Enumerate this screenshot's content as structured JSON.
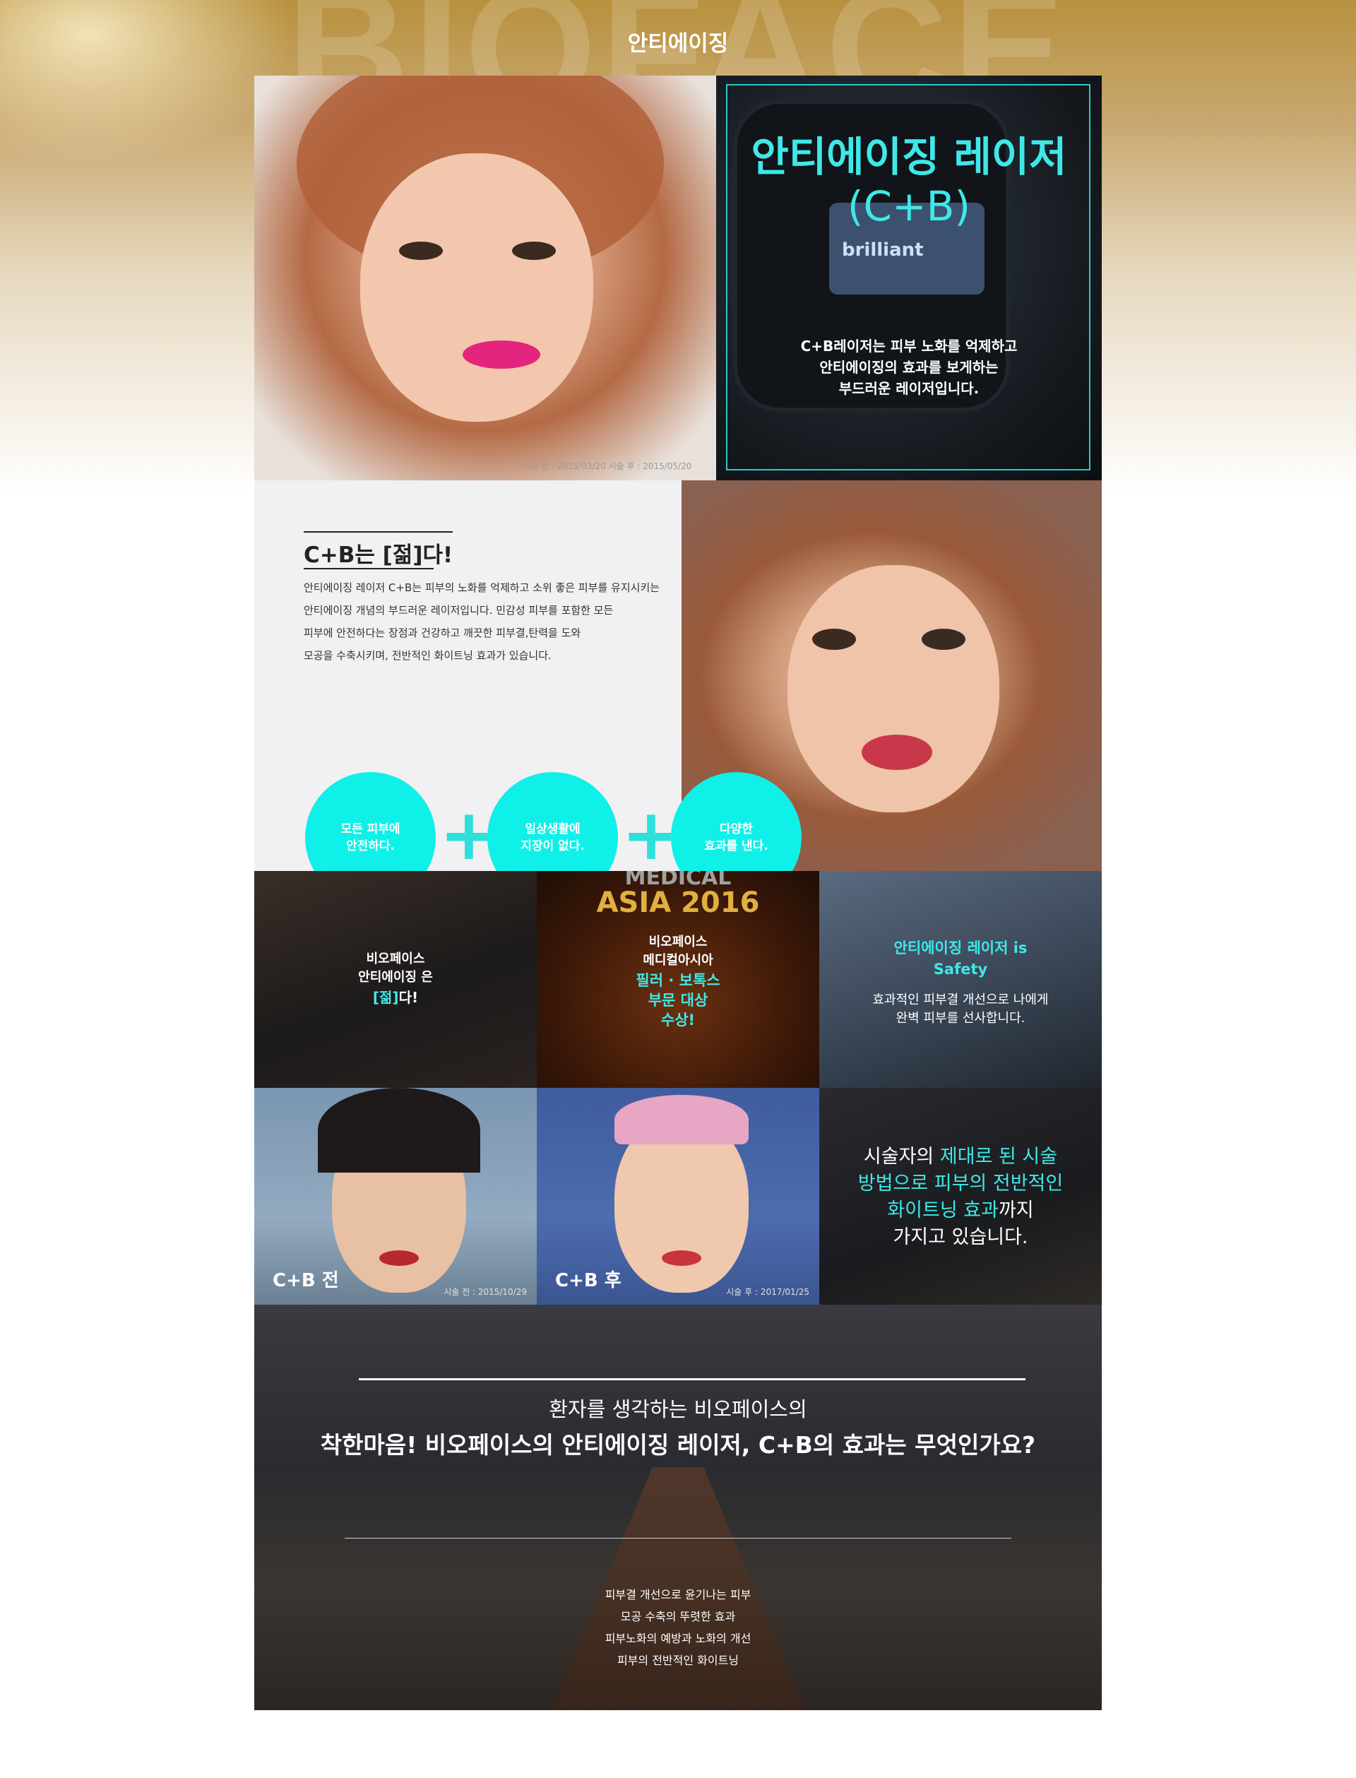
{
  "page_title": "안티에이징",
  "watermark": "BIOFACE",
  "hero": {
    "title_line1": "안티에이징 레이저",
    "title_line2": "(C+B)",
    "desc_lines": [
      "C+B레이저는 피부 노화를 억제하고",
      "안티에이징의 효과를 보게하는",
      "부드러운 레이저입니다."
    ],
    "photo_caption": "시술 전 : 2015/03/20      시술 후 : 2015/05/20",
    "device_label": "brilliant"
  },
  "intro": {
    "heading": "C+B는 [젊]다!",
    "paragraph_lines": [
      "안티에이징 레이저 C+B는 피부의 노화를 억제하고 소위 좋은 피부를 유지시키는",
      "안티에이징 개념의 부드러운 레이저입니다. 민감성 피부를 포함한 모든",
      "피부에 안전하다는 장점과 건강하고 깨끗한 피부결,탄력을 도와",
      "모공을 수축시키며, 전반적인 화이트닝 효과가 있습니다."
    ],
    "circles": [
      {
        "line1": "모든 피부에",
        "line2": "안전하다."
      },
      {
        "line1": "일상생활에",
        "line2": "지장이 없다."
      },
      {
        "line1": "다양한",
        "line2": "효과를 낸다."
      }
    ],
    "plus": "+"
  },
  "tiles": {
    "tile1": {
      "lines": [
        "비오페이스",
        "안티에이징 은"
      ],
      "accent": "[젊]",
      "tail": "다!"
    },
    "tile2": {
      "logo_line1": "MEDICAL",
      "logo_line2": "ASIA 2016",
      "lines": [
        "비오페이스",
        "메디컬아시아"
      ],
      "accent_lines": [
        "필러 · 보톡스",
        "부문 대상",
        "수상!"
      ]
    },
    "tile3": {
      "accent_lines": [
        "안티에이징 레이저 is",
        "Safety"
      ],
      "lines": [
        "효과적인 피부결 개선으로 나에게",
        "완벽 피부를 선사합니다."
      ]
    },
    "before": {
      "label": "C+B 전",
      "date": "시술 전 : 2015/10/29"
    },
    "after": {
      "label": "C+B 후",
      "date": "시술 후 : 2017/01/25"
    },
    "tile6": {
      "p1": "시술자의 ",
      "a1": "제대로 된 시술",
      "a2": "방법으로 피부의 전반적인",
      "a3": "화이트닝 효과",
      "p2": "까지",
      "p3": "가지고 있습니다."
    }
  },
  "closing": {
    "subtitle": "환자를 생각하는 비오페이스의",
    "title": "착한마음! 비오페이스의 안티에이징 레이저, C+B의 효과는 무엇인가요?",
    "effects": [
      "피부결 개선으로 윤기나는 피부",
      "모공 수축의 뚜렷한 효과",
      "피부노화의 예방과 노화의 개선",
      "피부의 전반적인 화이트닝"
    ]
  }
}
